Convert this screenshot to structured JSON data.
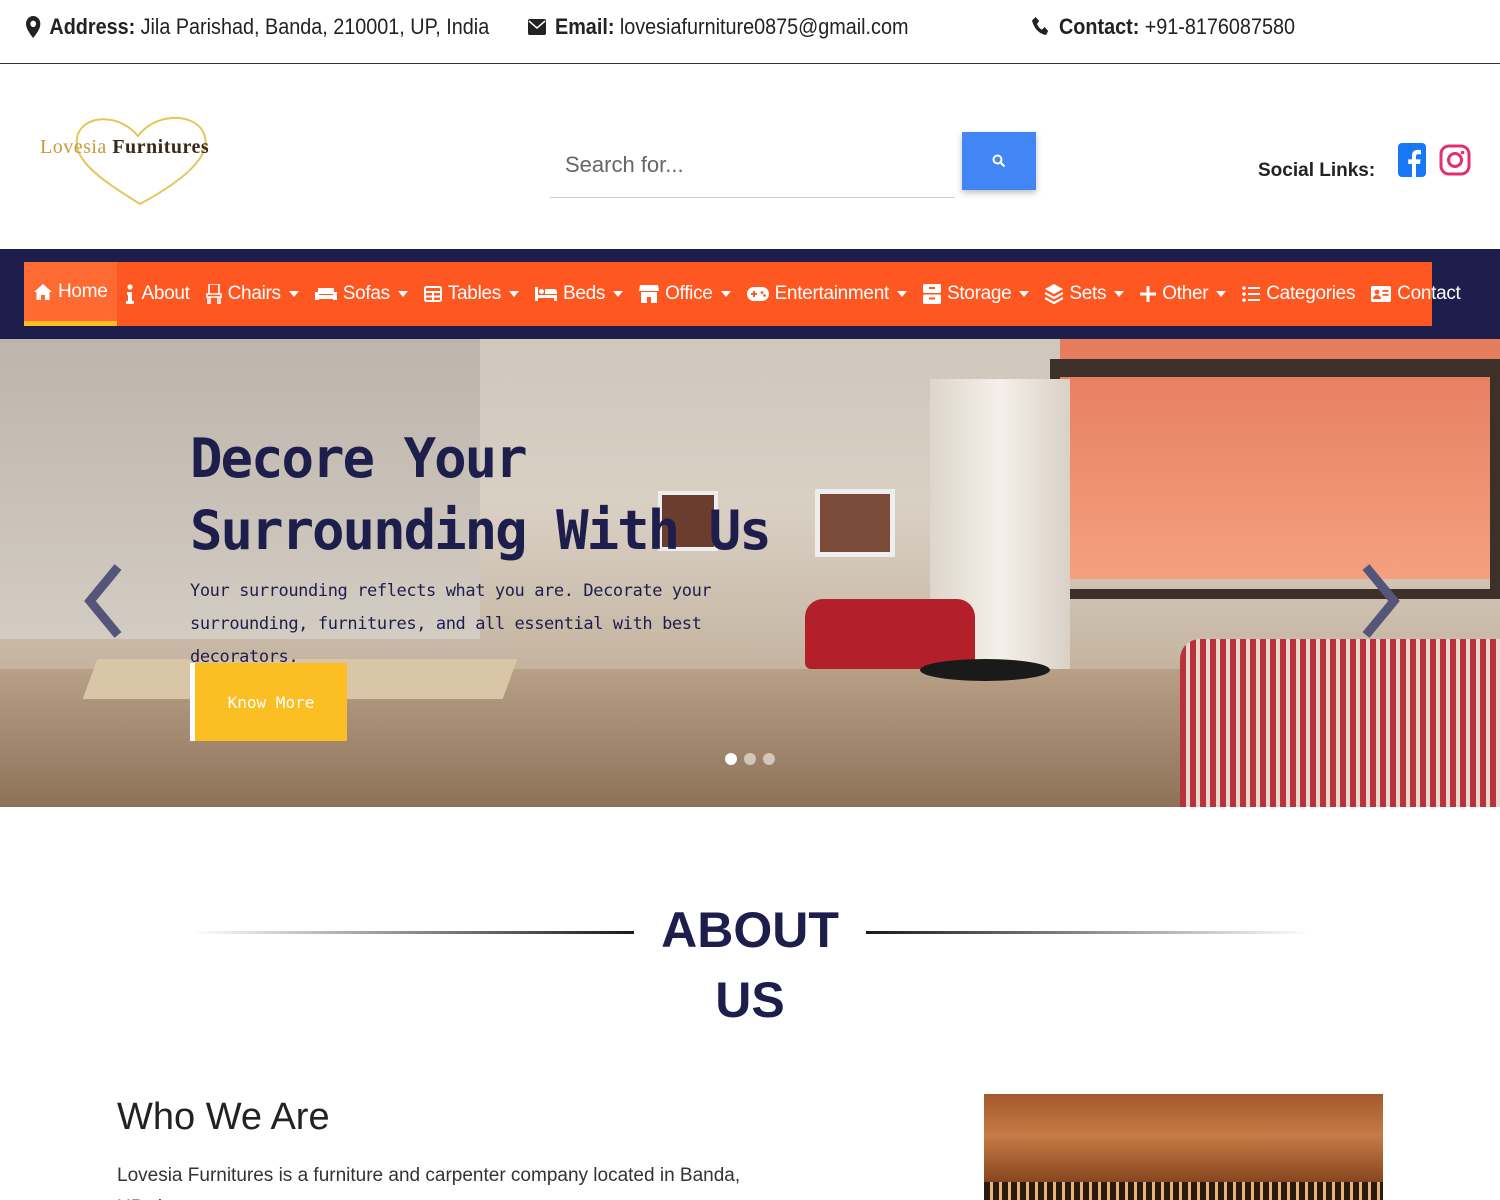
{
  "topbar": {
    "address_label": "Address:",
    "address": "Jila Parishad, Banda, 210001, UP, India",
    "email_label": "Email:",
    "email": "lovesiafurniture0875@gmail.com",
    "contact_label": "Contact:",
    "contact": "+91-8176087580"
  },
  "logo": {
    "text_a": "Lovesia",
    "text_b": "Furnitures"
  },
  "search": {
    "placeholder": "Search for..."
  },
  "social": {
    "label": "Social Links:",
    "icons": [
      "facebook-icon",
      "instagram-icon"
    ]
  },
  "nav": {
    "items": [
      {
        "label": "Home",
        "icon": "home-icon",
        "dropdown": false,
        "active": true
      },
      {
        "label": "About",
        "icon": "info-icon",
        "dropdown": false
      },
      {
        "label": "Chairs",
        "icon": "chair-icon",
        "dropdown": true
      },
      {
        "label": "Sofas",
        "icon": "couch-icon",
        "dropdown": true
      },
      {
        "label": "Tables",
        "icon": "table-icon",
        "dropdown": true
      },
      {
        "label": "Beds",
        "icon": "bed-icon",
        "dropdown": true
      },
      {
        "label": "Office",
        "icon": "store-icon",
        "dropdown": true
      },
      {
        "label": "Entertainment",
        "icon": "gamepad-icon",
        "dropdown": true
      },
      {
        "label": "Storage",
        "icon": "archive-icon",
        "dropdown": true
      },
      {
        "label": "Sets",
        "icon": "layers-icon",
        "dropdown": true
      },
      {
        "label": "Other",
        "icon": "plus-icon",
        "dropdown": true
      },
      {
        "label": "Categories",
        "icon": "list-icon",
        "dropdown": false
      },
      {
        "label": "Contact",
        "icon": "address-card-icon",
        "dropdown": false
      }
    ]
  },
  "hero": {
    "title": "Decore Your Surrounding With Us",
    "text": "Your surrounding reflects what you are. Decorate your surrounding, furnitures, and all essential with best decorators.",
    "button": "Know More",
    "slide_count": 3,
    "active_slide": 1
  },
  "about": {
    "heading": "ABOUT US",
    "who_title": "Who We Are",
    "who_text": "Lovesia Furnitures is a furniture and carpenter company located in Banda, UP since"
  },
  "colors": {
    "nav_bg": "#ff5722",
    "nav_band": "#1e1e4d",
    "accent_yellow": "#fbbf24",
    "search_button": "#4285f4",
    "heading_navy": "#1e1e4d"
  }
}
